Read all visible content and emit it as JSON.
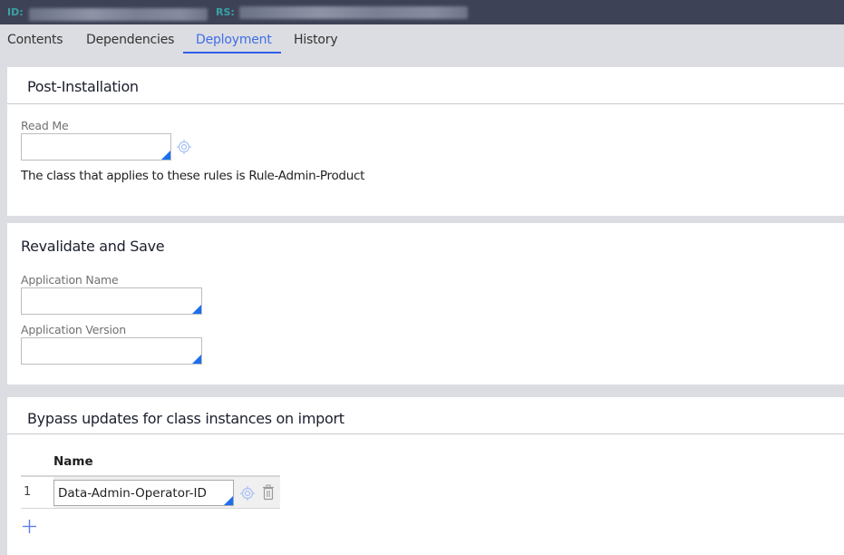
{
  "header": {
    "id_label": "ID:",
    "rs_label": "RS:"
  },
  "tabs": [
    {
      "label": "Contents",
      "active": false
    },
    {
      "label": "Dependencies",
      "active": false
    },
    {
      "label": "Deployment",
      "active": true
    },
    {
      "label": "History",
      "active": false
    }
  ],
  "post_installation": {
    "title": "Post-Installation",
    "read_me": {
      "label": "Read Me",
      "value": "",
      "picker_icon": "target-icon"
    },
    "class_note": "The class that applies to these rules is Rule-Admin-Product"
  },
  "revalidate": {
    "title": "Revalidate and Save",
    "application_name": {
      "label": "Application Name",
      "value": ""
    },
    "application_version": {
      "label": "Application Version",
      "value": ""
    }
  },
  "bypass": {
    "title": "Bypass updates for class instances on import",
    "column_header": "Name",
    "rows": [
      {
        "index": "1",
        "name": "Data-Admin-Operator-ID",
        "picker_icon": "target-icon",
        "delete_icon": "trash-icon"
      }
    ],
    "add_icon": "plus-icon"
  },
  "colors": {
    "accent": "#2f5ee8",
    "header_bg": "#3e4257",
    "header_label": "#38a3a5",
    "page_bg": "#dcdde2"
  }
}
